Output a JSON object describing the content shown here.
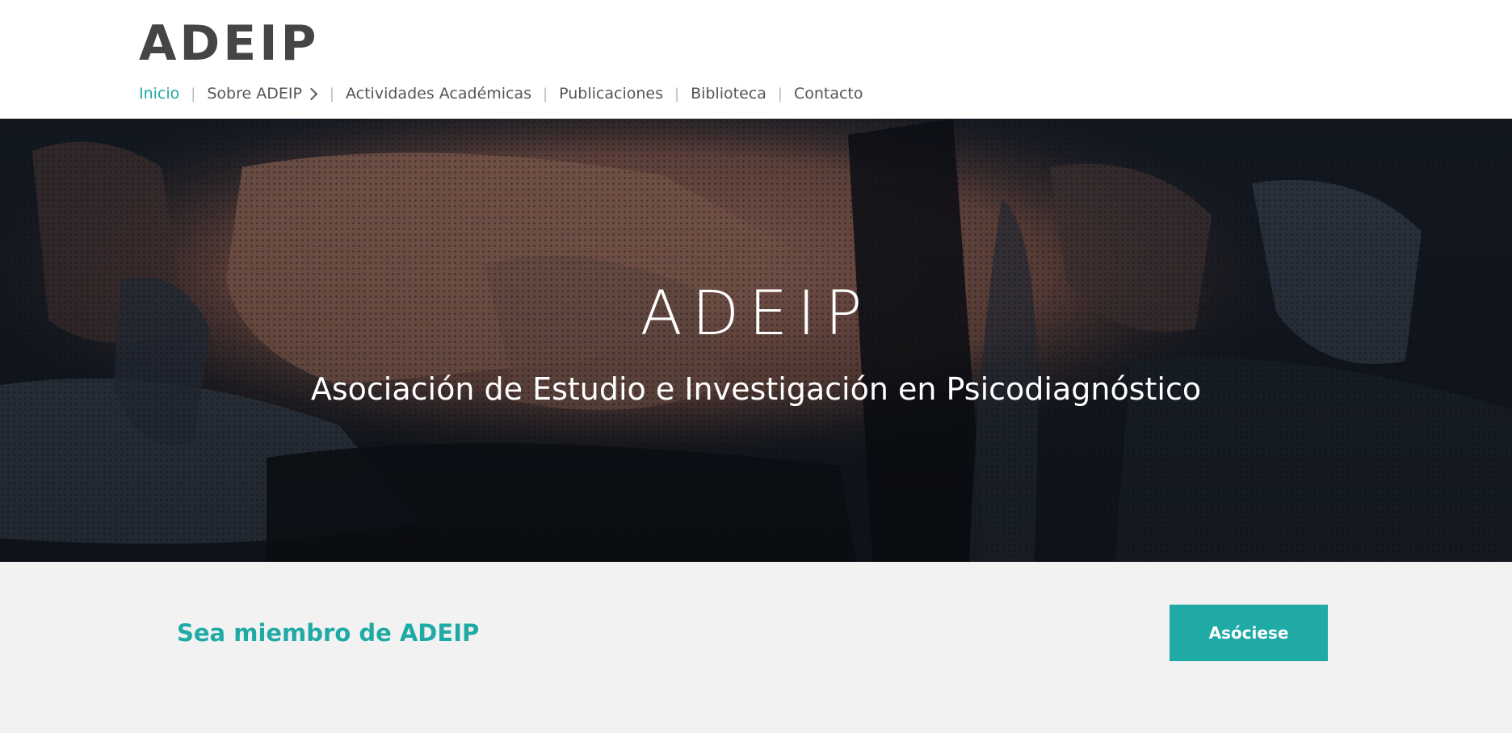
{
  "header": {
    "logo": "ADEIP",
    "nav": [
      {
        "label": "Inicio",
        "active": true
      },
      {
        "label": "Sobre ADEIP",
        "has_submenu": true
      },
      {
        "label": "Actividades Académicas"
      },
      {
        "label": "Publicaciones"
      },
      {
        "label": "Biblioteca"
      },
      {
        "label": "Contacto"
      }
    ],
    "separator": "|",
    "submenu_icon": "chevron-right-icon"
  },
  "hero": {
    "title": "ADEIP",
    "subtitle": "Asociación de Estudio e Investigación en Psicodiagnóstico",
    "background": "abstract dark blue and terracotta painted canvas"
  },
  "member": {
    "heading": "Sea miembro de ADEIP",
    "button": "Asóciese"
  },
  "colors": {
    "accent": "#1faaa6",
    "logo": "#454545",
    "nav_text": "#555555",
    "band_bg": "#f2f2f2"
  }
}
